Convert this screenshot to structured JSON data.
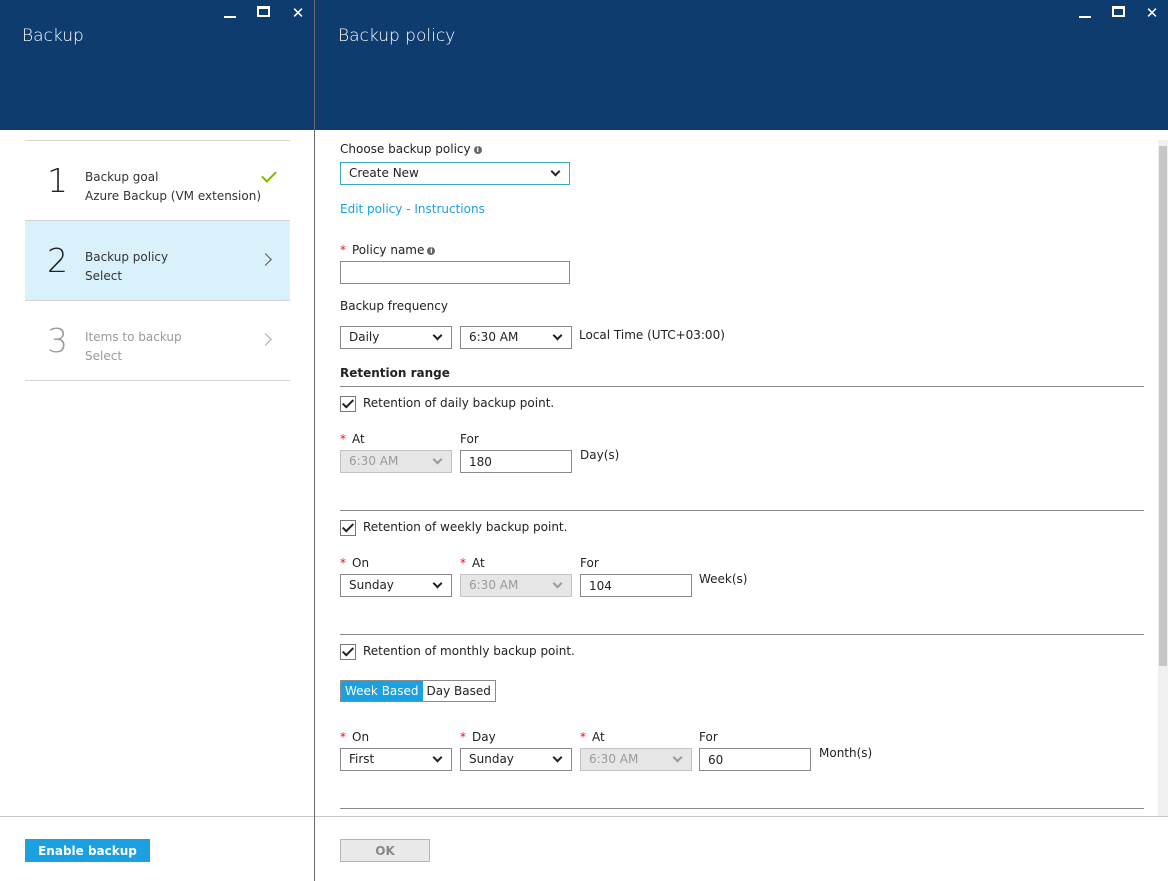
{
  "left_blade": {
    "title": "Backup",
    "controls": {
      "minimize": "—",
      "maximize": "☐",
      "close": "✕"
    },
    "steps": [
      {
        "number": "1",
        "title": "Backup goal",
        "subtitle": "Azure Backup (VM extension)",
        "state": "done"
      },
      {
        "number": "2",
        "title": "Backup policy",
        "subtitle": "Select",
        "state": "active"
      },
      {
        "number": "3",
        "title": "Items to backup",
        "subtitle": "Select",
        "state": "disabled"
      }
    ],
    "enable_button": "Enable backup"
  },
  "right_blade": {
    "title": "Backup policy",
    "controls": {
      "minimize": "—",
      "maximize": "☐",
      "close": "✕"
    },
    "choose_policy_label": "Choose backup policy",
    "choose_policy_value": "Create New",
    "edit_policy_link": "Edit policy - Instructions",
    "policy_name_label": "Policy name",
    "policy_name_value": "",
    "frequency": {
      "label": "Backup frequency",
      "interval": "Daily",
      "time": "6:30 AM",
      "timezone": "Local Time (UTC+03:00)"
    },
    "retention_title": "Retention range",
    "daily": {
      "checkbox_label": "Retention of daily backup point.",
      "checked": true,
      "at_label": "At",
      "at_value": "6:30 AM",
      "for_label": "For",
      "for_value": "180",
      "unit": "Day(s)"
    },
    "weekly": {
      "checkbox_label": "Retention of weekly backup point.",
      "checked": true,
      "on_label": "On",
      "on_value": "Sunday",
      "at_label": "At",
      "at_value": "6:30 AM",
      "for_label": "For",
      "for_value": "104",
      "unit": "Week(s)"
    },
    "monthly": {
      "checkbox_label": "Retention of monthly backup point.",
      "checked": true,
      "toggle": [
        "Week Based",
        "Day Based"
      ],
      "toggle_selected": "Week Based",
      "on_label": "On",
      "on_value": "First",
      "day_label": "Day",
      "day_value": "Sunday",
      "at_label": "At",
      "at_value": "6:30 AM",
      "for_label": "For",
      "for_value": "60",
      "unit": "Month(s)"
    },
    "ok_button": "OK"
  },
  "colors": {
    "header_bg": "#0f3c6e",
    "accent": "#1ba1e2",
    "active_step_bg": "#d8f1fa",
    "check_green": "#7fba00",
    "required_red": "#e81123"
  }
}
